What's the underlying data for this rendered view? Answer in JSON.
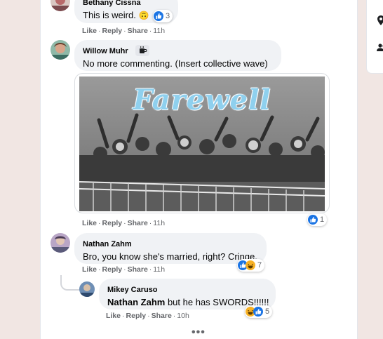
{
  "comments": [
    {
      "author": "Bethany Cissna",
      "text": "This is weird.",
      "emoji": "🙃",
      "actions": {
        "like": "Like",
        "reply": "Reply",
        "share": "Share",
        "time": "11h"
      },
      "reactions": {
        "icons": [
          "like"
        ],
        "count": "3"
      }
    },
    {
      "author": "Willow Muhr",
      "badge_icon": "coffee-cup-icon",
      "text": "No more commenting. (Insert collective wave)",
      "gif": {
        "title": "Farewell"
      },
      "actions": {
        "like": "Like",
        "reply": "Reply",
        "share": "Share",
        "time": "11h"
      },
      "reactions": {
        "icons": [
          "like"
        ],
        "count": "1"
      }
    },
    {
      "author": "Nathan Zahm",
      "text": "Bro, you know she's married, right? Cringe.",
      "actions": {
        "like": "Like",
        "reply": "Reply",
        "share": "Share",
        "time": "11h"
      },
      "reactions": {
        "icons": [
          "like",
          "laugh"
        ],
        "count": "7"
      }
    }
  ],
  "reply": {
    "author": "Mikey Caruso",
    "mention": "Nathan Zahm",
    "text": " but he has SWORDS!!!!!!",
    "actions": {
      "like": "Like",
      "reply": "Reply",
      "share": "Share",
      "time": "10h"
    },
    "reactions": {
      "icons": [
        "laugh",
        "like"
      ],
      "count": "5"
    }
  },
  "more_label": "•••",
  "sidebar": {
    "icons": [
      "location-pin-icon",
      "people-icon"
    ]
  },
  "colors": {
    "like": "#1b74e4",
    "laugh": "#f7b125",
    "bubble": "#f0f2f5",
    "meta": "#65676b",
    "page_bg": "#f1e6e3"
  }
}
